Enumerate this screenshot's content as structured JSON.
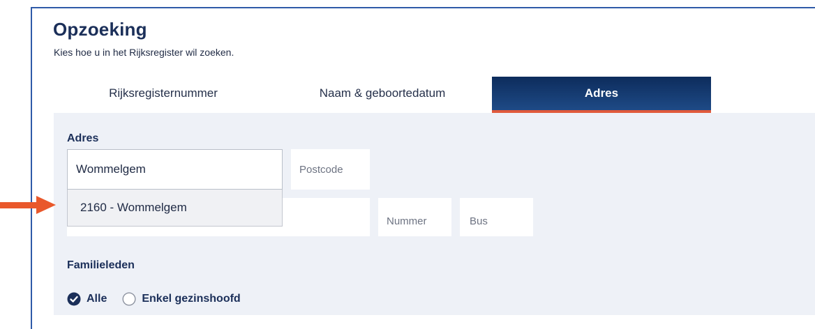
{
  "header": {
    "title": "Opzoeking",
    "subtitle": "Kies hoe u in het Rijksregister wil zoeken."
  },
  "tabs": [
    {
      "label": "Rijksregisternummer",
      "active": false
    },
    {
      "label": "Naam & geboortedatum",
      "active": false
    },
    {
      "label": "Adres",
      "active": true
    }
  ],
  "address": {
    "section_label": "Adres",
    "municipality_value": "Wommelgem",
    "postcode_placeholder": "Postcode",
    "number_placeholder": "Nummer",
    "bus_placeholder": "Bus",
    "suggestions": [
      "2160 - Wommelgem"
    ]
  },
  "family": {
    "section_label": "Familieleden",
    "options": [
      {
        "label": "Alle",
        "checked": true
      },
      {
        "label": "Enkel gezinshoofd",
        "checked": false
      }
    ]
  },
  "colors": {
    "accent": "#e05a3c",
    "tab_active": "#0d2c5c",
    "panel": "#eef1f7"
  }
}
